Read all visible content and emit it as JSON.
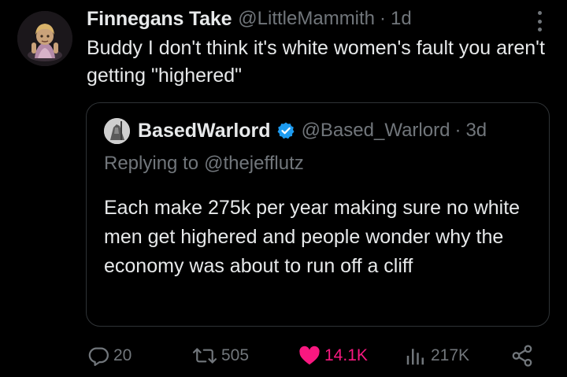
{
  "tweet": {
    "display_name": "Finnegans Take",
    "handle": "@LittleMammith",
    "separator": "·",
    "time": "1d",
    "text": "Buddy I don't think it's white women's fault you aren't getting \"highered\""
  },
  "quoted_tweet": {
    "display_name": "BasedWarlord",
    "handle": "@Based_Warlord",
    "separator": "·",
    "time": "3d",
    "replying_label": "Replying to",
    "replying_to": "@thejefflutz",
    "text": "Each make 275k per year making sure no white men get highered and people wonder why the economy was about to run off a cliff"
  },
  "actions": {
    "replies": "20",
    "retweets": "505",
    "likes": "14.1K",
    "views": "217K"
  },
  "icons": {
    "reply": "reply-icon",
    "retweet": "retweet-icon",
    "like": "heart-icon",
    "views": "views-icon",
    "share": "share-icon",
    "verified": "verified-badge-icon",
    "more": "more-icon"
  },
  "colors": {
    "background": "#000000",
    "text": "#e7e9ea",
    "muted": "#71767b",
    "like": "#f91880",
    "verified": "#1d9bf0",
    "border": "#2f3336"
  }
}
